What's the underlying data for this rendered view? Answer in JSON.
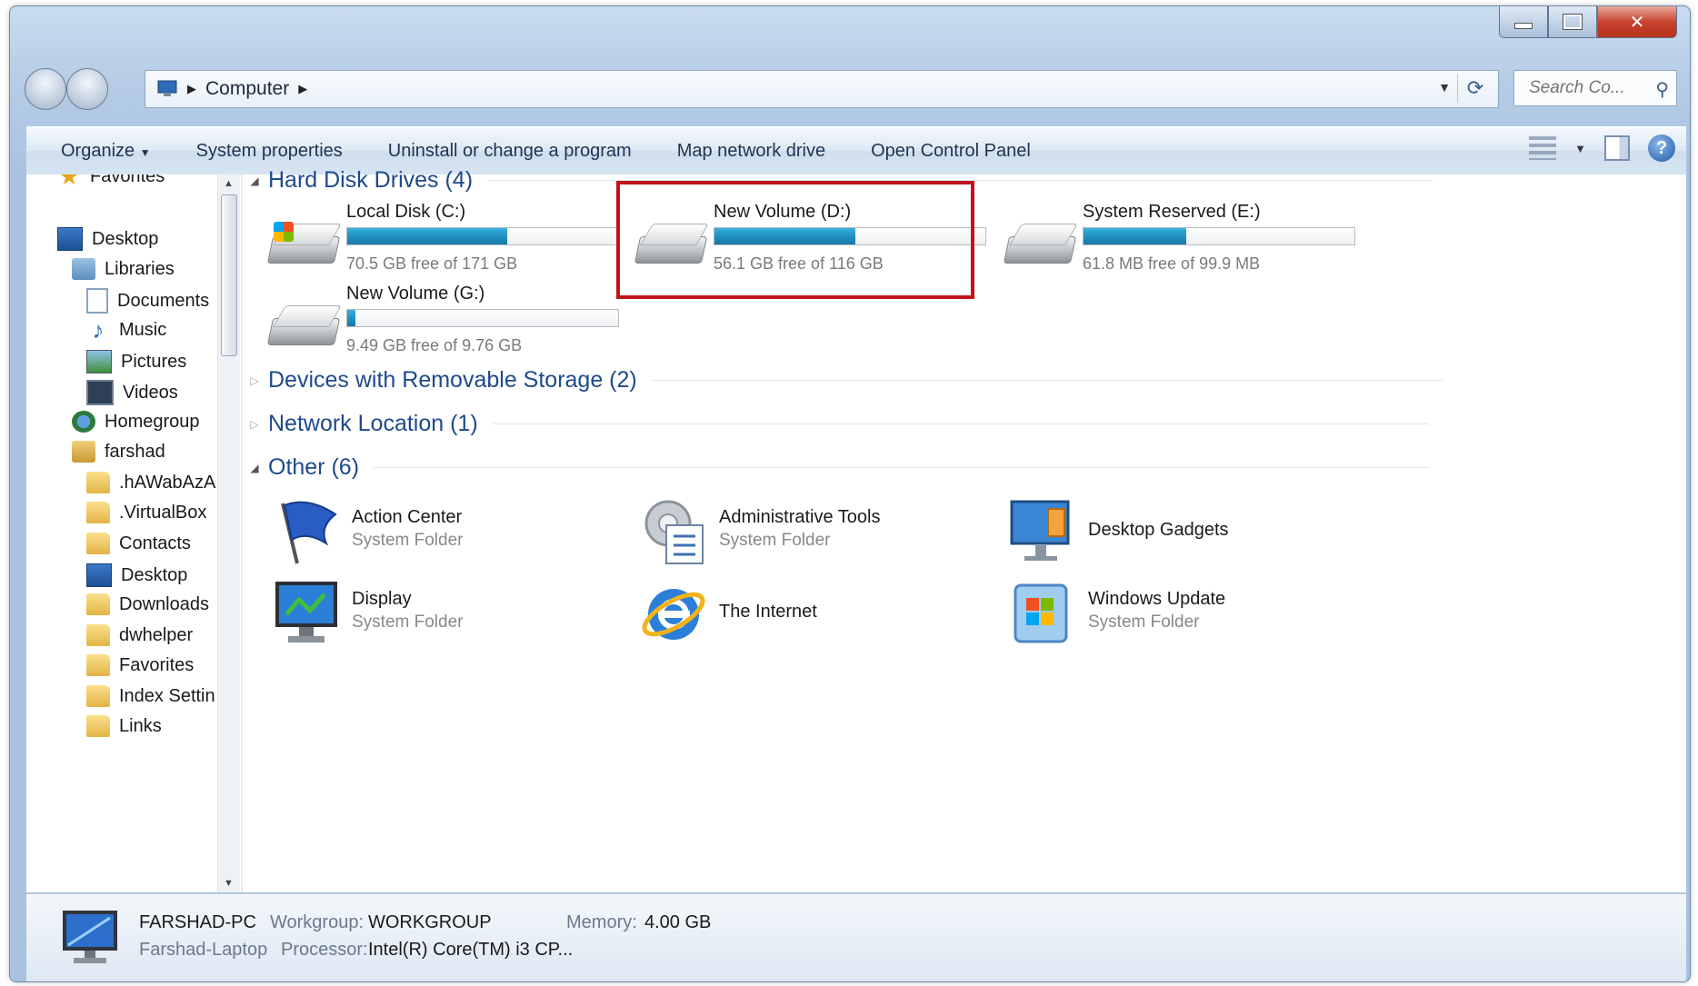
{
  "address": {
    "crumbs": [
      "Computer"
    ],
    "search_placeholder": "Search Co..."
  },
  "toolbar": {
    "organize": "Organize",
    "system_properties": "System properties",
    "uninstall": "Uninstall or change a program",
    "map_drive": "Map network drive",
    "open_control_panel": "Open Control Panel"
  },
  "sidebar": {
    "items": [
      {
        "label": "Favorites"
      },
      {
        "label": "Desktop"
      },
      {
        "label": "Libraries"
      },
      {
        "label": "Documents"
      },
      {
        "label": "Music"
      },
      {
        "label": "Pictures"
      },
      {
        "label": "Videos"
      },
      {
        "label": "Homegroup"
      },
      {
        "label": "farshad"
      },
      {
        "label": ".hAWabAzA"
      },
      {
        "label": ".VirtualBox"
      },
      {
        "label": "Contacts"
      },
      {
        "label": "Desktop"
      },
      {
        "label": "Downloads"
      },
      {
        "label": "dwhelper"
      },
      {
        "label": "Favorites"
      },
      {
        "label": "Index Settin"
      },
      {
        "label": "Links"
      }
    ]
  },
  "groups": {
    "hard_disks": "Hard Disk Drives (4)",
    "removable": "Devices with Removable Storage (2)",
    "network": "Network Location (1)",
    "other": "Other (6)"
  },
  "drives": [
    {
      "name": "Local Disk (C:)",
      "free": "70.5 GB free of 171 GB",
      "used_fraction": 0.59
    },
    {
      "name": "New Volume (D:)",
      "free": "56.1 GB free of 116 GB",
      "used_fraction": 0.52
    },
    {
      "name": "System Reserved (E:)",
      "free": "61.8 MB free of 99.9 MB",
      "used_fraction": 0.38
    },
    {
      "name": "New Volume (G:)",
      "free": "9.49 GB free of 9.76 GB",
      "used_fraction": 0.03
    }
  ],
  "other_items": [
    {
      "name": "Action Center",
      "sub": "System Folder"
    },
    {
      "name": "Administrative Tools",
      "sub": "System Folder"
    },
    {
      "name": "Desktop Gadgets",
      "sub": ""
    },
    {
      "name": "Display",
      "sub": "System Folder"
    },
    {
      "name": "The Internet",
      "sub": ""
    },
    {
      "name": "Windows Update",
      "sub": "System Folder"
    }
  ],
  "details": {
    "pc_name": "FARSHAD-PC",
    "pc_desc": "Farshad-Laptop",
    "workgroup_label": "Workgroup:",
    "workgroup_value": "WORKGROUP",
    "memory_label": "Memory:",
    "memory_value": "4.00 GB",
    "processor_label": "Processor:",
    "processor_value": "Intel(R) Core(TM) i3 CP..."
  },
  "colors": {
    "group_title": "#1e4a8c",
    "highlight_border": "#c0141b",
    "bar_fill": "#1e8fc0"
  }
}
